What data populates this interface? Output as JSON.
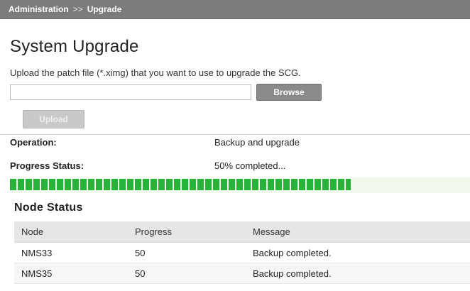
{
  "breadcrumb": {
    "section": "Administration",
    "separator": ">>",
    "page": "Upgrade"
  },
  "title": "System Upgrade",
  "upload": {
    "instructions": "Upload the patch file (*.ximg) that you want to use to upgrade the SCG.",
    "file_value": "",
    "browse_label": "Browse",
    "upload_label": "Upload"
  },
  "operation": {
    "label": "Operation:",
    "value": "Backup and upgrade"
  },
  "progress": {
    "label": "Progress Status:",
    "value": "50% completed...",
    "fraction": 0.5,
    "color": "#27b33a"
  },
  "node_status": {
    "title": "Node Status",
    "columns": [
      "Node",
      "Progress",
      "Message"
    ],
    "rows": [
      [
        "NMS33",
        "50",
        "Backup completed."
      ],
      [
        "NMS35",
        "50",
        "Backup completed."
      ]
    ]
  }
}
